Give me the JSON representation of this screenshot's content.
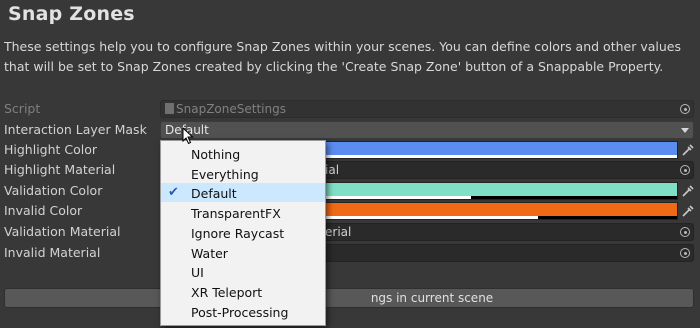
{
  "header": {
    "title": "Snap Zones",
    "description": "These settings help you to configure Snap Zones within your scenes. You can define colors and other values that will be set to Snap Zones created by clicking the 'Create Snap Zone' button of a Snappable Property."
  },
  "fields": {
    "script": {
      "label": "Script",
      "value": "SnapZoneSettings"
    },
    "interaction_layer_mask": {
      "label": "Interaction Layer Mask",
      "value": "Default"
    },
    "highlight_color": {
      "label": "Highlight Color",
      "color": "#5b8cf0"
    },
    "highlight_material": {
      "label": "Highlight Material",
      "value_visible": "ial"
    },
    "validation_color": {
      "label": "Validation Color",
      "color": "#7fe0c6"
    },
    "invalid_color": {
      "label": "Invalid Color",
      "color": "#f06a16"
    },
    "validation_material": {
      "label": "Validation Material",
      "value_visible": "erial"
    },
    "invalid_material": {
      "label": "Invalid Material"
    }
  },
  "bottom_button": {
    "label_visible": "ngs in current scene"
  },
  "layer_dropdown": {
    "options": [
      "Nothing",
      "Everything",
      "Default",
      "TransparentFX",
      "Ignore Raycast",
      "Water",
      "UI",
      "XR Teleport",
      "Post-Processing"
    ],
    "selected": "Default",
    "check_icon": "checkmark-icon"
  },
  "colors": {
    "background": "#383838",
    "popup_background": "#f2f2f2",
    "popup_selected": "#cce8ff"
  }
}
